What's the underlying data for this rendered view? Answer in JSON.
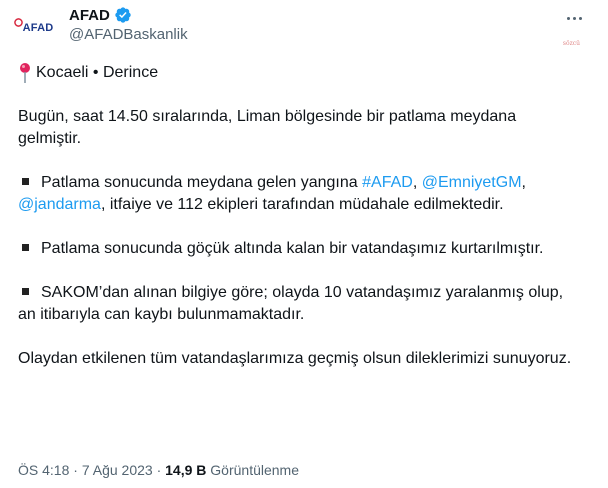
{
  "account": {
    "avatar_text": "AFAD",
    "name": "AFAD",
    "handle": "@AFADBaskanlik",
    "watermark": "sözcü"
  },
  "tweet": {
    "location": "Kocaeli • Derince",
    "p1": "Bugün, saat 14.50 sıralarında, Liman bölgesinde bir patlama meydana gelmiştir.",
    "p2_pre": "Patlama sonucunda meydana gelen yangına ",
    "p2_link1": "#AFAD",
    "p2_sep1": ", ",
    "p2_link2": "@EmniyetGM",
    "p2_sep2": ", ",
    "p2_link3": "@jandarma",
    "p2_post": ", itfaiye ve 112 ekipleri tarafından müdahale edilmektedir.",
    "p3": "Patlama sonucunda göçük altında kalan bir vatandaşımız kurtarılmıştır.",
    "p4": "SAKOM’dan alınan bilgiye göre; olayda 10 vatandaşımız yaralanmış olup, an itibarıyla can kaybı bulunmamaktadır.",
    "p5": "Olaydan etkilenen tüm vatandaşlarımıza geçmiş olsun dileklerimizi sunuyoruz."
  },
  "meta": {
    "time": "ÖS 4:18",
    "dot": " · ",
    "date": "7 Ağu 2023",
    "views_count": "14,9 B",
    "views_label": "Görüntülenme"
  },
  "colors": {
    "link": "#1d9bf0",
    "verified": "#1d9bf0",
    "secondary_text": "#536471",
    "pin": "#e0245e"
  },
  "icons": [
    "verified-badge-icon",
    "more-icon",
    "pin-icon",
    "bullet-icon"
  ]
}
